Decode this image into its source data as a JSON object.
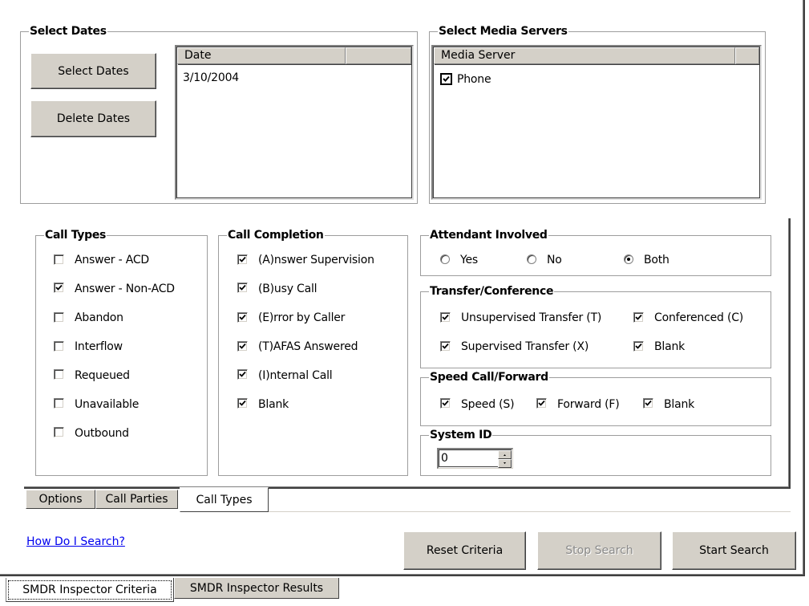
{
  "select_dates": {
    "title": "Select Dates",
    "select_button": "Select Dates",
    "delete_button": "Delete Dates",
    "column_header": "Date",
    "rows": [
      "3/10/2004"
    ]
  },
  "media_servers": {
    "title": "Select Media Servers",
    "column_header": "Media Server",
    "items": [
      {
        "label": "Phone",
        "checked": true
      }
    ]
  },
  "call_types": {
    "title": "Call Types",
    "items": [
      {
        "label": "Answer - ACD",
        "checked": false
      },
      {
        "label": "Answer - Non-ACD",
        "checked": true
      },
      {
        "label": "Abandon",
        "checked": false
      },
      {
        "label": "Interflow",
        "checked": false
      },
      {
        "label": "Requeued",
        "checked": false
      },
      {
        "label": "Unavailable",
        "checked": false
      },
      {
        "label": "Outbound",
        "checked": false
      }
    ]
  },
  "call_completion": {
    "title": "Call Completion",
    "items": [
      {
        "label": "(A)nswer Supervision",
        "checked": true
      },
      {
        "label": "(B)usy Call",
        "checked": true
      },
      {
        "label": "(E)rror by Caller",
        "checked": true
      },
      {
        "label": "(T)AFAS Answered",
        "checked": true
      },
      {
        "label": "(I)nternal Call",
        "checked": true
      },
      {
        "label": "Blank",
        "checked": true
      }
    ]
  },
  "attendant": {
    "title": "Attendant Involved",
    "options": [
      "Yes",
      "No",
      "Both"
    ],
    "selected": "Both"
  },
  "transfer": {
    "title": "Transfer/Conference",
    "unsupervised": "Unsupervised Transfer (T)",
    "conferenced": "Conferenced (C)",
    "supervised": "Supervised Transfer (X)",
    "blank": "Blank"
  },
  "speed": {
    "title": "Speed Call/Forward",
    "speed": "Speed (S)",
    "forward": "Forward (F)",
    "blank": "Blank"
  },
  "system_id": {
    "title": "System ID",
    "value": "0"
  },
  "inner_tabs": [
    "Options",
    "Call Parties",
    "Call Types"
  ],
  "inner_tab_active": "Call Types",
  "help_link": "How Do I Search?",
  "buttons": {
    "reset": "Reset Criteria",
    "stop": "Stop Search",
    "start": "Start Search"
  },
  "outer_tabs": [
    "SMDR Inspector Criteria",
    "SMDR Inspector Results"
  ],
  "outer_tab_active": "SMDR Inspector Criteria"
}
